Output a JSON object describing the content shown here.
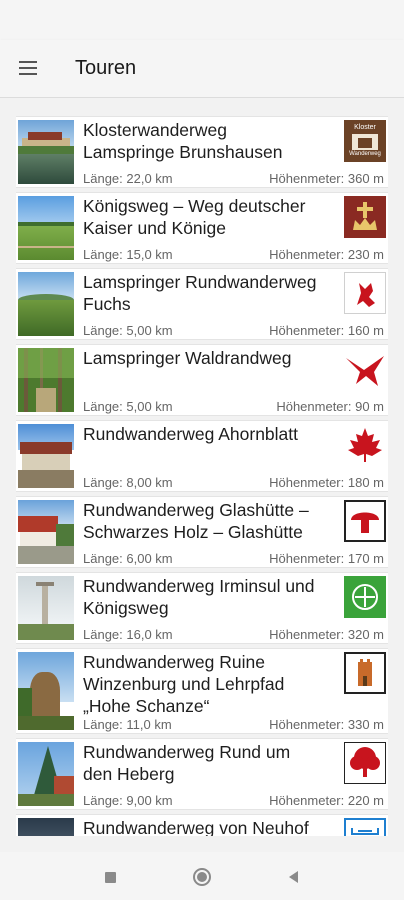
{
  "toolbar": {
    "title": "Touren",
    "menu_icon": "hamburger-menu-icon"
  },
  "tours": [
    {
      "title": "Klosterwanderweg\nLamspringe Brunshausen",
      "length": "Länge: 22,0 km",
      "elevation": "Höhenmeter: 360 m",
      "logo": "kloster-wanderweg-sign-icon",
      "logo_lines": [
        "Kloster",
        "Wanderweg"
      ],
      "photo": "monastery-lake-photo"
    },
    {
      "title": "Königsweg – Weg deutscher\nKaiser und Könige",
      "length": "Länge: 15,0 km",
      "elevation": "Höhenmeter: 230 m",
      "logo": "crown-cross-icon",
      "photo": "green-meadow-photo"
    },
    {
      "title": "Lamspringer Rundwanderweg\nFuchs",
      "length": "Länge: 5,00 km",
      "elevation": "Höhenmeter: 160 m",
      "logo": "red-fox-icon",
      "photo": "field-hills-photo"
    },
    {
      "title": "Lamspringer Waldrandweg",
      "length": "Länge: 5,00 km",
      "elevation": "Höhenmeter: 90 m",
      "logo": "red-bird-icon",
      "photo": "forest-path-photo"
    },
    {
      "title": "Rundwanderweg Ahornblatt",
      "length": "Länge: 8,00 km",
      "elevation": "Höhenmeter: 180 m",
      "logo": "maple-leaf-icon",
      "photo": "village-houses-photo"
    },
    {
      "title": "Rundwanderweg Glashütte –\nSchwarzes Holz – Glashütte",
      "length": "Länge: 6,00 km",
      "elevation": "Höhenmeter: 170 m",
      "logo": "red-mushroom-icon",
      "photo": "red-roof-house-photo"
    },
    {
      "title": "Rundwanderweg Irminsul und\nKönigsweg",
      "length": "Länge: 16,0 km",
      "elevation": "Höhenmeter: 320 m",
      "logo": "green-crosshair-icon",
      "photo": "irminsul-column-photo"
    },
    {
      "title": "Rundwanderweg Ruine\nWinzenburg und Lehrpfad\n„Hohe Schanze“",
      "length": "Länge: 11,0 km",
      "elevation": "Höhenmeter: 330 m",
      "logo": "castle-ruin-icon",
      "photo": "castle-ruin-photo"
    },
    {
      "title": "Rundwanderweg Rund um\nden Heberg",
      "length": "Länge: 9,00 km",
      "elevation": "Höhenmeter: 220 m",
      "logo": "red-tree-icon",
      "photo": "spruce-tree-photo"
    },
    {
      "title": "Rundwanderweg von Neuhof",
      "length": "",
      "elevation": "",
      "logo": "blue-bracket-icon",
      "photo": "neuhof-roof-photo"
    }
  ],
  "navbar": {
    "recents": "square-recents-icon",
    "home": "circle-home-icon",
    "back": "triangle-back-icon"
  },
  "colors": {
    "logo_red": "#c8141e",
    "logo_brown": "#6b4226",
    "logo_green": "#3aa33a",
    "logo_blue": "#1e7fd0"
  }
}
